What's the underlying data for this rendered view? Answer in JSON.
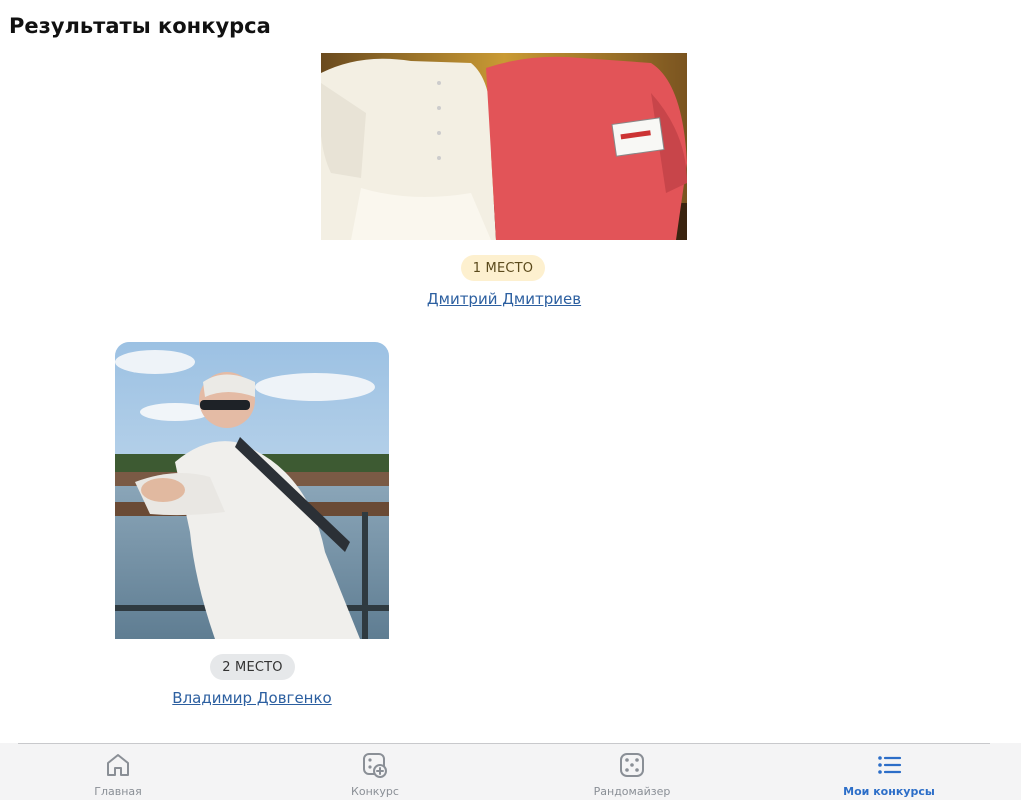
{
  "header": {
    "title": "Результаты конкурса"
  },
  "results": [
    {
      "place_label": "1 МЕСТО",
      "name": "Дмитрий Дмитриев",
      "badge_color": "#fdf0cf"
    },
    {
      "place_label": "2 МЕСТО",
      "name": "Владимир Довгенко",
      "badge_color": "#e6e8ea"
    }
  ],
  "tabbar": {
    "items": [
      {
        "label": "Главная",
        "icon": "home-icon",
        "active": false
      },
      {
        "label": "Конкурс",
        "icon": "add-contest-icon",
        "active": false
      },
      {
        "label": "Рандомайзер",
        "icon": "dice-icon",
        "active": false
      },
      {
        "label": "Мои конкурсы",
        "icon": "list-icon",
        "active": true
      }
    ],
    "active_color": "#2c6ec8",
    "inactive_color": "#8a8f96"
  }
}
